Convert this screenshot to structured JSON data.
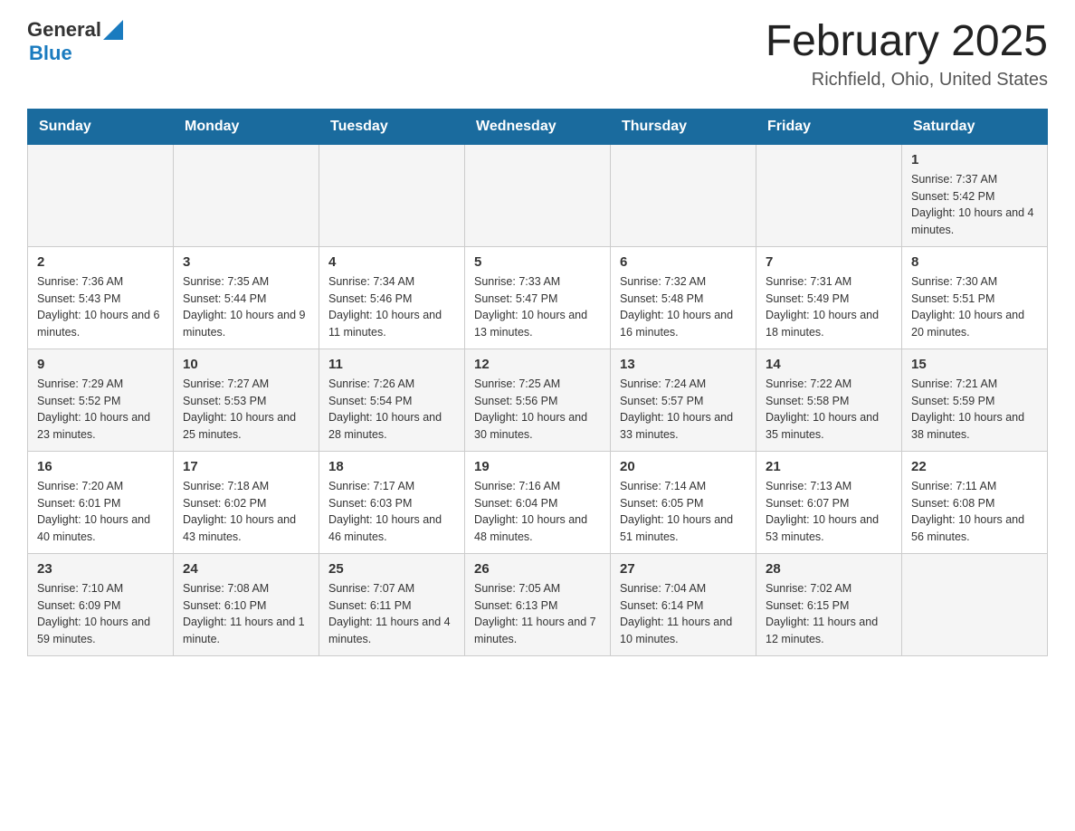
{
  "header": {
    "logo_general": "General",
    "logo_blue": "Blue",
    "month_title": "February 2025",
    "location": "Richfield, Ohio, United States"
  },
  "weekdays": [
    "Sunday",
    "Monday",
    "Tuesday",
    "Wednesday",
    "Thursday",
    "Friday",
    "Saturday"
  ],
  "weeks": [
    [
      {
        "day": "",
        "info": ""
      },
      {
        "day": "",
        "info": ""
      },
      {
        "day": "",
        "info": ""
      },
      {
        "day": "",
        "info": ""
      },
      {
        "day": "",
        "info": ""
      },
      {
        "day": "",
        "info": ""
      },
      {
        "day": "1",
        "info": "Sunrise: 7:37 AM\nSunset: 5:42 PM\nDaylight: 10 hours and 4 minutes."
      }
    ],
    [
      {
        "day": "2",
        "info": "Sunrise: 7:36 AM\nSunset: 5:43 PM\nDaylight: 10 hours and 6 minutes."
      },
      {
        "day": "3",
        "info": "Sunrise: 7:35 AM\nSunset: 5:44 PM\nDaylight: 10 hours and 9 minutes."
      },
      {
        "day": "4",
        "info": "Sunrise: 7:34 AM\nSunset: 5:46 PM\nDaylight: 10 hours and 11 minutes."
      },
      {
        "day": "5",
        "info": "Sunrise: 7:33 AM\nSunset: 5:47 PM\nDaylight: 10 hours and 13 minutes."
      },
      {
        "day": "6",
        "info": "Sunrise: 7:32 AM\nSunset: 5:48 PM\nDaylight: 10 hours and 16 minutes."
      },
      {
        "day": "7",
        "info": "Sunrise: 7:31 AM\nSunset: 5:49 PM\nDaylight: 10 hours and 18 minutes."
      },
      {
        "day": "8",
        "info": "Sunrise: 7:30 AM\nSunset: 5:51 PM\nDaylight: 10 hours and 20 minutes."
      }
    ],
    [
      {
        "day": "9",
        "info": "Sunrise: 7:29 AM\nSunset: 5:52 PM\nDaylight: 10 hours and 23 minutes."
      },
      {
        "day": "10",
        "info": "Sunrise: 7:27 AM\nSunset: 5:53 PM\nDaylight: 10 hours and 25 minutes."
      },
      {
        "day": "11",
        "info": "Sunrise: 7:26 AM\nSunset: 5:54 PM\nDaylight: 10 hours and 28 minutes."
      },
      {
        "day": "12",
        "info": "Sunrise: 7:25 AM\nSunset: 5:56 PM\nDaylight: 10 hours and 30 minutes."
      },
      {
        "day": "13",
        "info": "Sunrise: 7:24 AM\nSunset: 5:57 PM\nDaylight: 10 hours and 33 minutes."
      },
      {
        "day": "14",
        "info": "Sunrise: 7:22 AM\nSunset: 5:58 PM\nDaylight: 10 hours and 35 minutes."
      },
      {
        "day": "15",
        "info": "Sunrise: 7:21 AM\nSunset: 5:59 PM\nDaylight: 10 hours and 38 minutes."
      }
    ],
    [
      {
        "day": "16",
        "info": "Sunrise: 7:20 AM\nSunset: 6:01 PM\nDaylight: 10 hours and 40 minutes."
      },
      {
        "day": "17",
        "info": "Sunrise: 7:18 AM\nSunset: 6:02 PM\nDaylight: 10 hours and 43 minutes."
      },
      {
        "day": "18",
        "info": "Sunrise: 7:17 AM\nSunset: 6:03 PM\nDaylight: 10 hours and 46 minutes."
      },
      {
        "day": "19",
        "info": "Sunrise: 7:16 AM\nSunset: 6:04 PM\nDaylight: 10 hours and 48 minutes."
      },
      {
        "day": "20",
        "info": "Sunrise: 7:14 AM\nSunset: 6:05 PM\nDaylight: 10 hours and 51 minutes."
      },
      {
        "day": "21",
        "info": "Sunrise: 7:13 AM\nSunset: 6:07 PM\nDaylight: 10 hours and 53 minutes."
      },
      {
        "day": "22",
        "info": "Sunrise: 7:11 AM\nSunset: 6:08 PM\nDaylight: 10 hours and 56 minutes."
      }
    ],
    [
      {
        "day": "23",
        "info": "Sunrise: 7:10 AM\nSunset: 6:09 PM\nDaylight: 10 hours and 59 minutes."
      },
      {
        "day": "24",
        "info": "Sunrise: 7:08 AM\nSunset: 6:10 PM\nDaylight: 11 hours and 1 minute."
      },
      {
        "day": "25",
        "info": "Sunrise: 7:07 AM\nSunset: 6:11 PM\nDaylight: 11 hours and 4 minutes."
      },
      {
        "day": "26",
        "info": "Sunrise: 7:05 AM\nSunset: 6:13 PM\nDaylight: 11 hours and 7 minutes."
      },
      {
        "day": "27",
        "info": "Sunrise: 7:04 AM\nSunset: 6:14 PM\nDaylight: 11 hours and 10 minutes."
      },
      {
        "day": "28",
        "info": "Sunrise: 7:02 AM\nSunset: 6:15 PM\nDaylight: 11 hours and 12 minutes."
      },
      {
        "day": "",
        "info": ""
      }
    ]
  ]
}
